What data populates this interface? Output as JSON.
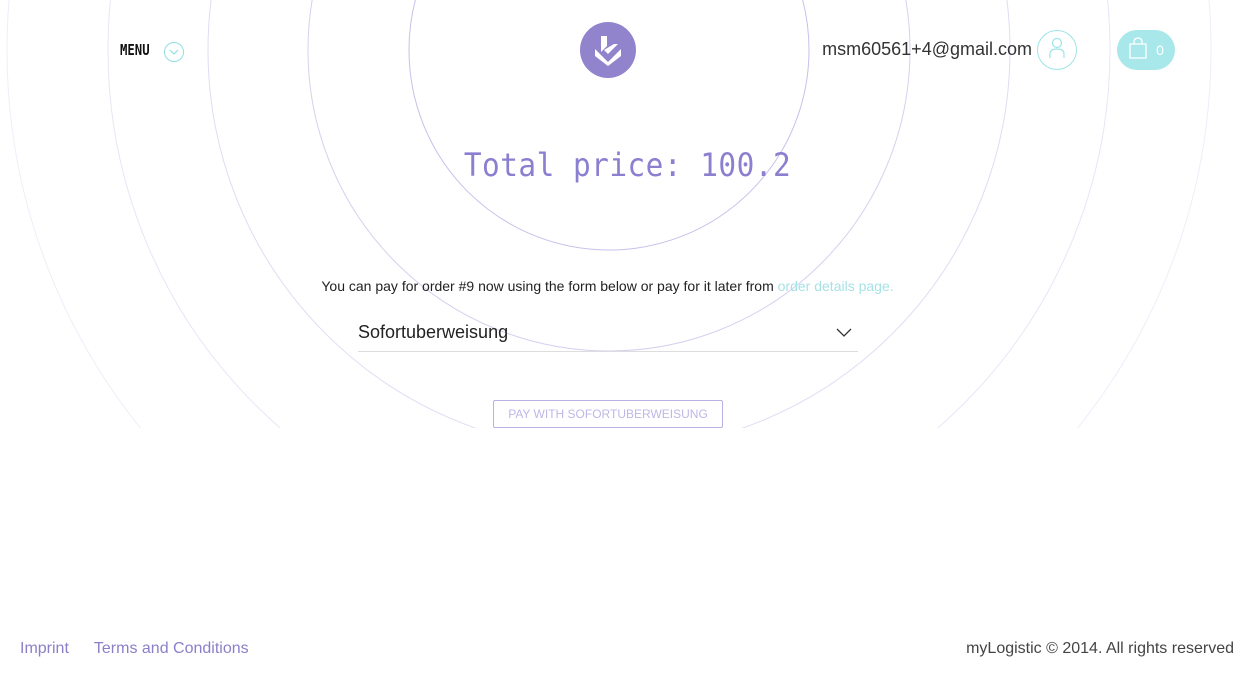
{
  "header": {
    "menu_label": "MENU",
    "user_email": "msm60561+4@gmail.com",
    "cart_count": "0"
  },
  "main": {
    "total_price": "Total price: 100.2",
    "pay_info_text": "You can pay for order #9 now using the form below or pay for it later from",
    "pay_info_link": "order details page.",
    "payment_method_selected": "Sofortuberweisung",
    "pay_button_label": "PAY WITH SOFORTUBERWEISUNG"
  },
  "footer": {
    "imprint_label": "Imprint",
    "terms_label": "Terms and Conditions",
    "copyright": "myLogistic © 2014. All rights reserved"
  },
  "colors": {
    "accent_purple": "#8b7fd0",
    "logo_purple": "#9183cc",
    "accent_cyan": "#a8e8ea",
    "link_cyan": "#a6e2e5"
  },
  "icons": {
    "logo": "brand-logo-icon",
    "menu": "chevron-down-icon",
    "user": "user-icon",
    "cart": "shopping-bag-icon",
    "select": "chevron-down-icon"
  }
}
